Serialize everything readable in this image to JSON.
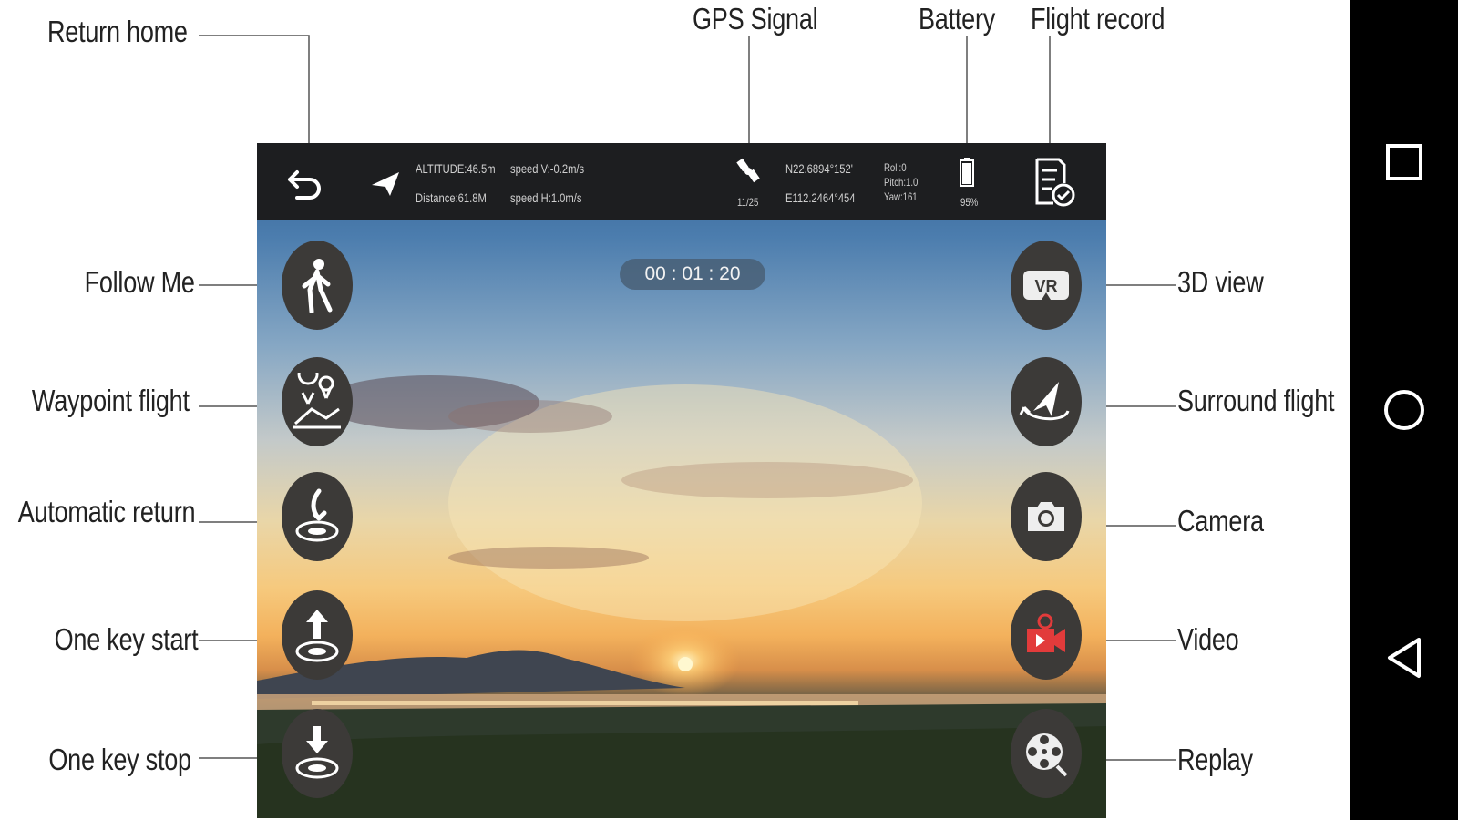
{
  "labels": {
    "return_home": "Return home",
    "gps_signal": "GPS Signal",
    "battery": "Battery",
    "flight_record": "Flight record",
    "follow_me": "Follow Me",
    "waypoint_flight": "Waypoint flight",
    "automatic_return": "Automatic return",
    "one_key_start": "One key start",
    "one_key_stop": "One key stop",
    "view_3d": "3D view",
    "surround_flight": "Surround flight",
    "camera": "Camera",
    "video": "Video",
    "replay": "Replay"
  },
  "telemetry": {
    "altitude": "ALTITUDE:46.5m",
    "vertical_speed": "speed V:-0.2m/s",
    "distance": "Distance:61.8M",
    "horizontal_speed": "speed H:1.0m/s",
    "satellites": "11/25",
    "latitude": "N22.6894°152'",
    "longitude": "E112.2464°454",
    "roll": "Roll:0",
    "pitch": "Pitch:1.0",
    "yaw": "Yaw:161",
    "battery_level": "95%"
  },
  "timer": "00 : 01 : 20",
  "colors": {
    "topbar": "#1d1e20",
    "button_bg": "#3c3a38",
    "video_accent": "#e23b3b",
    "navbar": "#000000"
  },
  "icons": {
    "return_home": "return-arrow-icon",
    "aircraft": "paper-plane-icon",
    "gps": "satellite-icon",
    "battery": "battery-icon",
    "flight_record": "document-check-icon",
    "follow_me": "walking-person-icon",
    "waypoint": "map-pin-icon",
    "automatic_return": "landing-arrow-icon",
    "one_key_start": "takeoff-arrow-icon",
    "one_key_stop": "landing-arrow-icon",
    "view_3d": "vr-goggles-icon",
    "surround_flight": "orbit-plane-icon",
    "camera": "camera-icon",
    "video": "video-camera-icon",
    "replay": "film-reel-icon",
    "nav_recents": "square-icon",
    "nav_home": "circle-icon",
    "nav_back": "triangle-back-icon"
  }
}
